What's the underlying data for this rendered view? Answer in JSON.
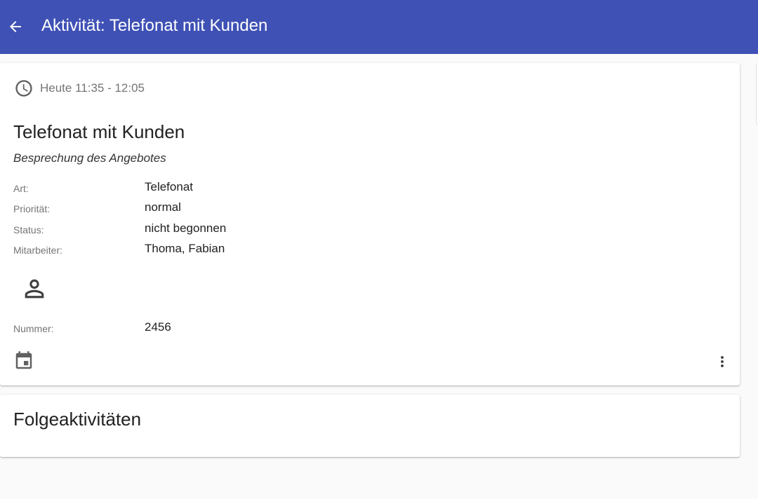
{
  "appbar": {
    "title": "Aktivität: Telefonat mit Kunden",
    "back_icon": "arrow-back-icon",
    "color": "#3f51b5"
  },
  "activity": {
    "time_icon": "clock-icon",
    "time": "Heute 11:35 - 12:05",
    "title": "Telefonat mit Kunden",
    "subtitle": "Besprechung des Angebotes",
    "fields": [
      {
        "label": "Art:",
        "value": "Telefonat"
      },
      {
        "label": "Priorität:",
        "value": "normal"
      },
      {
        "label": "Status:",
        "value": "nicht begonnen"
      },
      {
        "label": "Mitarbeiter:",
        "value": "Thoma, Fabian"
      }
    ],
    "contact_icon": "person-icon",
    "contact_fields": [
      {
        "label": "Nummer:",
        "value": "2456"
      }
    ],
    "calendar_icon": "calendar-icon",
    "more_icon": "more-vert-icon"
  },
  "follow_up": {
    "title": "Folgeaktivitäten"
  }
}
